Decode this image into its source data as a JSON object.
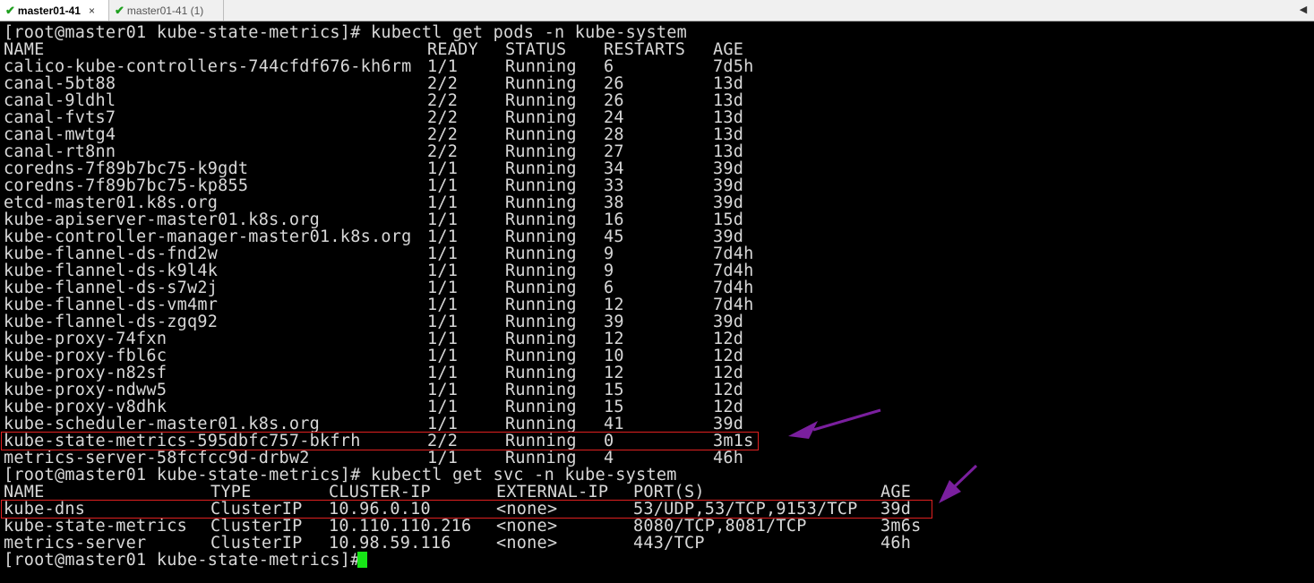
{
  "tabs": [
    {
      "label": "master01-41",
      "active": true,
      "close": "×"
    },
    {
      "label": "master01-41 (1)",
      "active": false
    }
  ],
  "scroll_arrow": "◀",
  "prompt": "[root@master01 kube-state-metrics]# ",
  "commands": {
    "pods": "kubectl get pods -n kube-system",
    "svc": "kubectl get svc -n kube-system"
  },
  "pods": {
    "headers": [
      "NAME",
      "READY",
      "STATUS",
      "RESTARTS",
      "AGE"
    ],
    "rows": [
      [
        "calico-kube-controllers-744cfdf676-kh6rm",
        "1/1",
        "Running",
        "6",
        "7d5h"
      ],
      [
        "canal-5bt88",
        "2/2",
        "Running",
        "26",
        "13d"
      ],
      [
        "canal-9ldhl",
        "2/2",
        "Running",
        "26",
        "13d"
      ],
      [
        "canal-fvts7",
        "2/2",
        "Running",
        "24",
        "13d"
      ],
      [
        "canal-mwtg4",
        "2/2",
        "Running",
        "28",
        "13d"
      ],
      [
        "canal-rt8nn",
        "2/2",
        "Running",
        "27",
        "13d"
      ],
      [
        "coredns-7f89b7bc75-k9gdt",
        "1/1",
        "Running",
        "34",
        "39d"
      ],
      [
        "coredns-7f89b7bc75-kp855",
        "1/1",
        "Running",
        "33",
        "39d"
      ],
      [
        "etcd-master01.k8s.org",
        "1/1",
        "Running",
        "38",
        "39d"
      ],
      [
        "kube-apiserver-master01.k8s.org",
        "1/1",
        "Running",
        "16",
        "15d"
      ],
      [
        "kube-controller-manager-master01.k8s.org",
        "1/1",
        "Running",
        "45",
        "39d"
      ],
      [
        "kube-flannel-ds-fnd2w",
        "1/1",
        "Running",
        "9",
        "7d4h"
      ],
      [
        "kube-flannel-ds-k9l4k",
        "1/1",
        "Running",
        "9",
        "7d4h"
      ],
      [
        "kube-flannel-ds-s7w2j",
        "1/1",
        "Running",
        "6",
        "7d4h"
      ],
      [
        "kube-flannel-ds-vm4mr",
        "1/1",
        "Running",
        "12",
        "7d4h"
      ],
      [
        "kube-flannel-ds-zgq92",
        "1/1",
        "Running",
        "39",
        "39d"
      ],
      [
        "kube-proxy-74fxn",
        "1/1",
        "Running",
        "12",
        "12d"
      ],
      [
        "kube-proxy-fbl6c",
        "1/1",
        "Running",
        "10",
        "12d"
      ],
      [
        "kube-proxy-n82sf",
        "1/1",
        "Running",
        "12",
        "12d"
      ],
      [
        "kube-proxy-ndww5",
        "1/1",
        "Running",
        "15",
        "12d"
      ],
      [
        "kube-proxy-v8dhk",
        "1/1",
        "Running",
        "15",
        "12d"
      ],
      [
        "kube-scheduler-master01.k8s.org",
        "1/1",
        "Running",
        "41",
        "39d"
      ],
      [
        "kube-state-metrics-595dbfc757-bkfrh",
        "2/2",
        "Running",
        "0",
        "3m1s"
      ],
      [
        "metrics-server-58fcfcc9d-drbw2",
        "1/1",
        "Running",
        "4",
        "46h"
      ]
    ]
  },
  "svc": {
    "headers": [
      "NAME",
      "TYPE",
      "CLUSTER-IP",
      "EXTERNAL-IP",
      "PORT(S)",
      "AGE"
    ],
    "rows": [
      [
        "kube-dns",
        "ClusterIP",
        "10.96.0.10",
        "<none>",
        "53/UDP,53/TCP,9153/TCP",
        "39d"
      ],
      [
        "kube-state-metrics",
        "ClusterIP",
        "10.110.110.216",
        "<none>",
        "8080/TCP,8081/TCP",
        "3m6s"
      ],
      [
        "metrics-server",
        "ClusterIP",
        "10.98.59.116",
        "<none>",
        "443/TCP",
        "46h"
      ]
    ]
  },
  "colors": {
    "terminal_bg": "#000000",
    "terminal_fg": "#d8d8d8",
    "cursor": "#17e617",
    "highlight_box": "#e02020",
    "annotation_arrow": "#7a1f9e",
    "tab_check": "#1fa01f"
  }
}
